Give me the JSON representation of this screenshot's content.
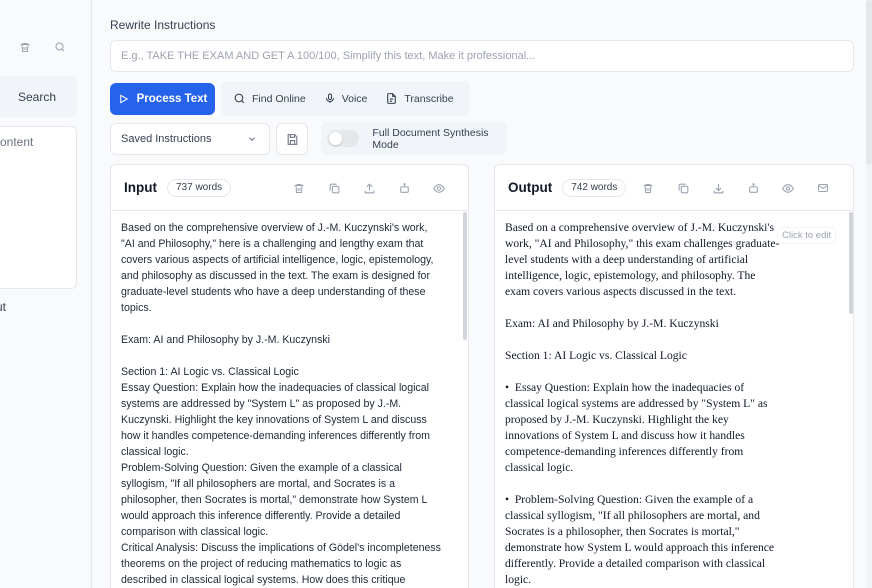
{
  "sidebar": {
    "search_label": "Search",
    "card_text": "content",
    "partial_text": "ut"
  },
  "rewrite": {
    "label": "Rewrite Instructions",
    "placeholder": "E.g., TAKE THE EXAM AND GET A 100/100, Simplify this text, Make it professional..."
  },
  "toolbar": {
    "process_label": "Process Text",
    "find_online_label": "Find Online",
    "voice_label": "Voice",
    "transcribe_label": "Transcribe"
  },
  "options": {
    "saved_instructions_label": "Saved Instructions",
    "synthesis_toggle_label": "Full Document Synthesis Mode",
    "synthesis_enabled": false
  },
  "input_panel": {
    "title": "Input",
    "word_count": "737 words",
    "text": "Based on the comprehensive overview of J.-M. Kuczynski's work,\n\"AI and Philosophy,\" here is a challenging and lengthy exam that\ncovers various aspects of artificial intelligence, logic, epistemology,\nand philosophy as discussed in the text. The exam is designed for\ngraduate-level students who have a deep understanding of these\ntopics.\n\nExam: AI and Philosophy by J.-M. Kuczynski\n\nSection 1: AI Logic vs. Classical Logic\nEssay Question: Explain how the inadequacies of classical logical\nsystems are addressed by \"System L\" as proposed by J.-M.\nKuczynski. Highlight the key innovations of System L and discuss\nhow it handles competence-demanding inferences differently from\nclassical logic.\nProblem-Solving Question: Given the example of a classical\nsyllogism, \"If all philosophers are mortal, and Socrates is a\nphilosopher, then Socrates is mortal,\" demonstrate how System L\nwould approach this inference differently. Provide a detailed\ncomparison with classical logic.\nCritical Analysis: Discuss the implications of Gödel's incompleteness\ntheorems on the project of reducing mathematics to logic as\ndescribed in classical logical systems. How does this critique"
  },
  "output_panel": {
    "title": "Output",
    "word_count": "742 words",
    "tooltip": "Click to edit",
    "text": "Based on a comprehensive overview of J.-M. Kuczynski's\nwork, \"AI and Philosophy,\" this exam challenges graduate-\nlevel students with a deep understanding of artificial\nintelligence, logic, epistemology, and philosophy. The\nexam covers various aspects discussed in the text.\n\nExam: AI and Philosophy by J.-M. Kuczynski\n\nSection 1: AI Logic vs. Classical Logic\n\n•  Essay Question: Explain how the inadequacies of\nclassical logical systems are addressed by \"System L\" as\nproposed by J.-M. Kuczynski. Highlight the key\ninnovations of System L and discuss how it handles\ncompetence-demanding inferences differently from\nclassical logic.\n\n•  Problem-Solving Question: Given the example of a\nclassical syllogism, \"If all philosophers are mortal, and\nSocrates is a philosopher, then Socrates is mortal,\"\ndemonstrate how System L would approach this inference\ndifferently. Provide a detailed comparison with classical\nlogic."
  },
  "icons": {
    "trash": "trash-icon",
    "search": "search-icon",
    "play": "play-icon",
    "mic": "mic-icon",
    "transcribe": "transcribe-icon",
    "chevron": "chevron-down-icon",
    "save": "save-icon",
    "copy": "copy-icon",
    "upload": "upload-icon",
    "download": "download-icon",
    "bot": "bot-icon",
    "eye": "eye-icon",
    "mail": "mail-icon"
  },
  "colors": {
    "primary": "#2563eb",
    "border": "#e5e7eb",
    "muted": "#9ca3af",
    "background": "#f8fafc"
  }
}
